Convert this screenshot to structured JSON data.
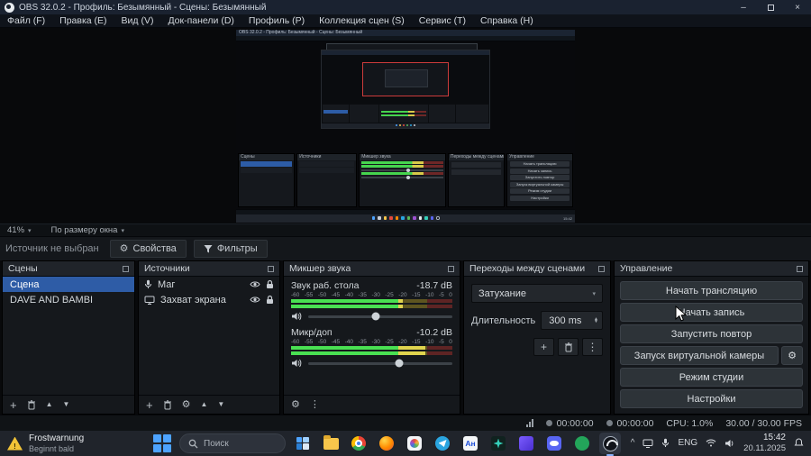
{
  "window": {
    "title": "OBS 32.0.2 - Профиль: Безымянный - Сцены: Безымянный",
    "menu": [
      "Файл (F)",
      "Правка (E)",
      "Вид (V)",
      "Док-панели (D)",
      "Профиль (P)",
      "Коллекция сцен (S)",
      "Сервис (T)",
      "Справка (H)"
    ]
  },
  "preview": {
    "zoom": "41%",
    "fit_mode": "По размеру окна"
  },
  "source_bar": {
    "status": "Источник не выбран",
    "properties": "Свойства",
    "filters": "Фильтры"
  },
  "scenes": {
    "title": "Сцены",
    "items": [
      {
        "label": "Сцена",
        "selected": true
      },
      {
        "label": "DAVE AND BAMBI",
        "selected": false
      }
    ]
  },
  "sources": {
    "title": "Источники",
    "items": [
      {
        "label": "Маг"
      },
      {
        "label": "Захват экрана"
      }
    ]
  },
  "mixer": {
    "title": "Микшер звука",
    "scale": [
      "-60",
      "-55",
      "-50",
      "-45",
      "-40",
      "-35",
      "-30",
      "-25",
      "-20",
      "-15",
      "-10",
      "-5",
      "0"
    ],
    "channels": [
      {
        "name": "Звук раб. стола",
        "db": "-18.7 dB",
        "level_pct": 69,
        "fader_pct": 47
      },
      {
        "name": "Микр/доп",
        "db": "-10.2 dB",
        "level_pct": 83,
        "fader_pct": 63
      }
    ]
  },
  "transitions": {
    "title": "Переходы между сценами",
    "transition": "Затухание",
    "duration_label": "Длительность",
    "duration": "300 ms"
  },
  "controls": {
    "title": "Управление",
    "buttons": [
      "Начать трансляцию",
      "Начать запись",
      "Запустить повтор",
      "Запуск виртуальной камеры",
      "Режим студии",
      "Настройки"
    ]
  },
  "status": {
    "stream_time": "00:00:00",
    "rec_time": "00:00:00",
    "cpu": "CPU: 1.0%",
    "fps": "30.00 / 30.00 FPS"
  },
  "taskbar": {
    "weather_title": "Frostwarnung",
    "weather_subtitle": "Beginnt bald",
    "search_placeholder": "Поиск",
    "anki_label": "Ан",
    "language": "ENG",
    "time": "15:42",
    "date": "20.11.2025"
  },
  "icons": {
    "chevron_down": "▾",
    "chevron_up": "^",
    "dots": "⋮",
    "plus": "+",
    "gear": "⚙",
    "arrow_up": "▲",
    "arrow_down": "▼",
    "minimize": "–",
    "close": "×",
    "warning_mark": "!"
  }
}
